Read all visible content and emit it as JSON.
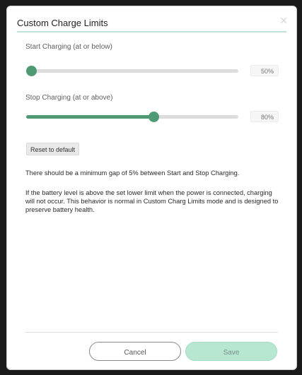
{
  "dialog": {
    "title": "Custom Charge Limits",
    "close_icon": "close-icon"
  },
  "start": {
    "label": "Start Charging (at or below)",
    "value": 0,
    "value_text": "50%"
  },
  "stop": {
    "label": "Stop Charging (at or above)",
    "value": 60,
    "value_text": "80%"
  },
  "reset": {
    "label": "Reset to default"
  },
  "notes": {
    "gap": "There should be a minimum gap of 5% between Start and Stop Charging.",
    "behavior": "If the battery level is above the set lower limit when the power is connected, charging will not occur. This behavior is normal in Custom Charg Limits mode and is designed to preserve battery health."
  },
  "footer": {
    "cancel_label": "Cancel",
    "save_label": "Save"
  },
  "colors": {
    "accent": "#4f9a74",
    "track": "#dcdcdc",
    "save_bg": "#b7e6d1",
    "title_rule": "#bfe3dc"
  }
}
